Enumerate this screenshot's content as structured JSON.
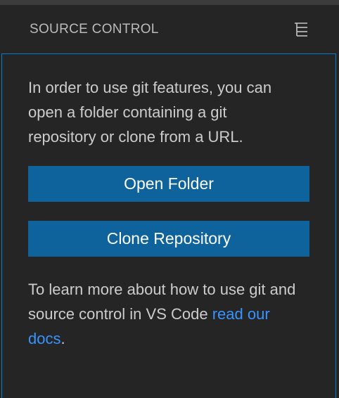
{
  "header": {
    "title": "SOURCE CONTROL",
    "action_icon": "tree-view-icon"
  },
  "empty_view": {
    "message": "In order to use git features, you can open a folder containing a git repository or clone from a URL.",
    "open_folder_label": "Open Folder",
    "clone_repository_label": "Clone Repository",
    "learn_more_text": "To learn more about how to use git and source control in VS Code",
    "docs_link_label": "read our docs",
    "trailing_punct": "."
  },
  "colors": {
    "background": "#252526",
    "button": "#0e639c",
    "link": "#3794ff",
    "focus_border": "#007fd4"
  }
}
